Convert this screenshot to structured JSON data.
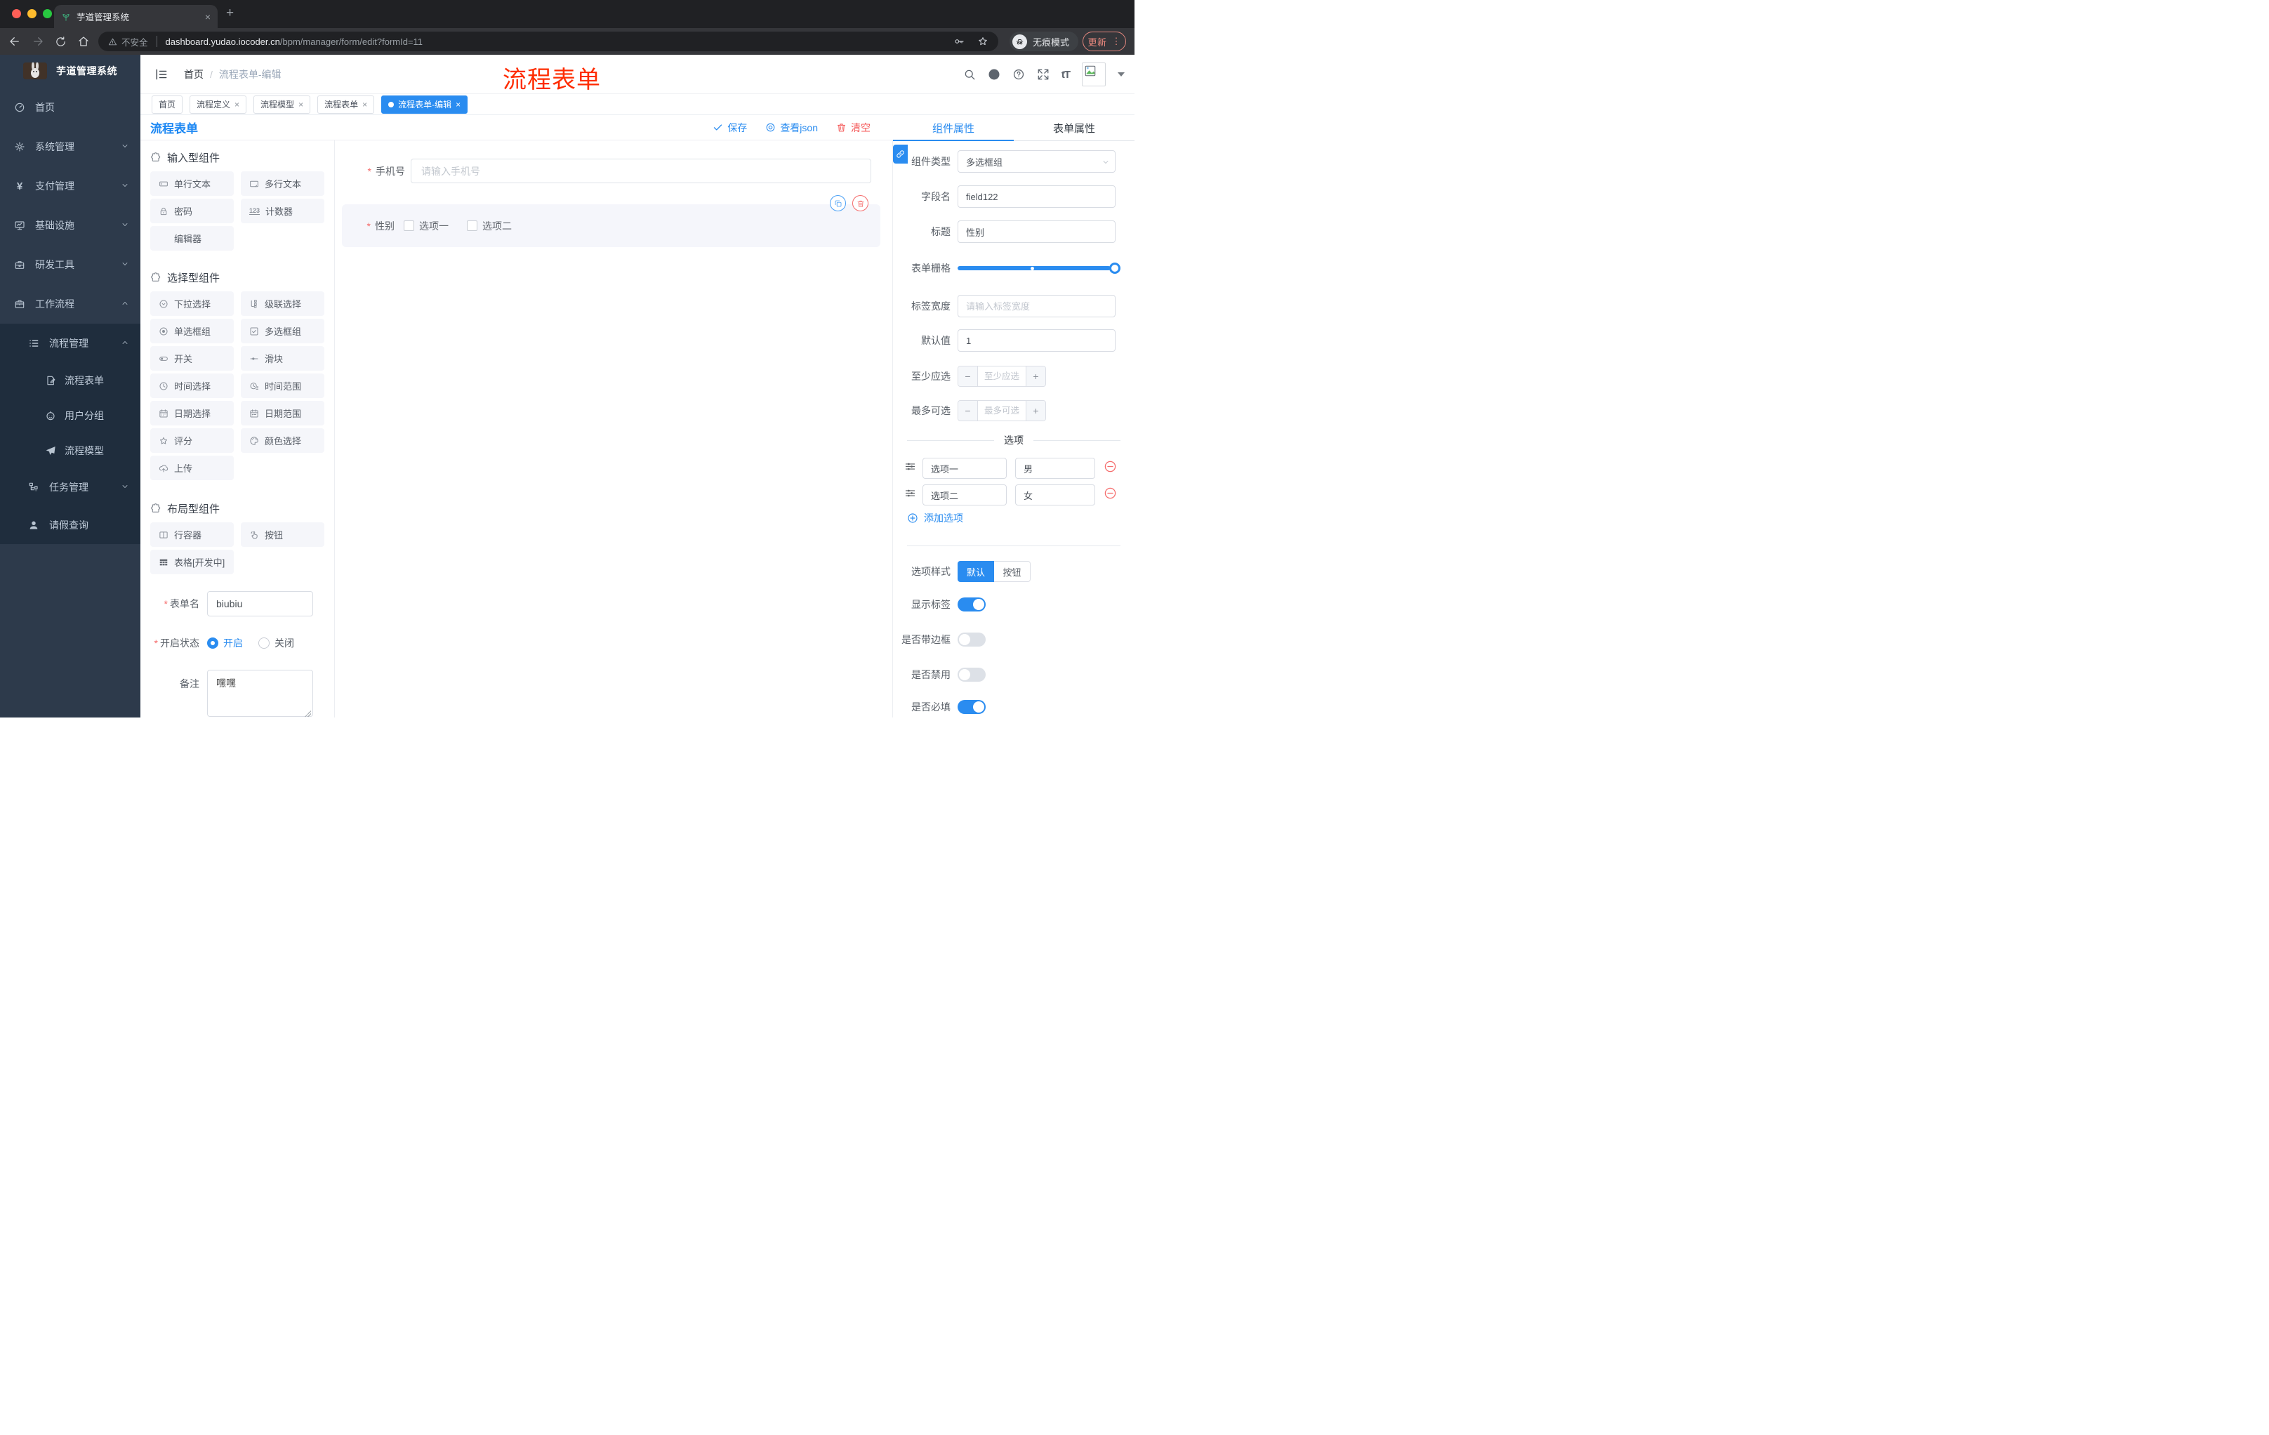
{
  "browser": {
    "tab_title": "芋道管理系统",
    "not_secure_label": "不安全",
    "url_host": "dashboard.yudao.iocoder.cn",
    "url_path": "/bpm/manager/form/edit?formId=11",
    "incognito_label": "无痕模式",
    "update_label": "更新"
  },
  "ui": {
    "close": "×",
    "plus": "+",
    "kebab": "⋮",
    "slash": "/",
    "asterisk": "*",
    "tT": "tT",
    "num": "123",
    "yen": "¥"
  },
  "sidebar": {
    "app_title": "芋道管理系统",
    "items": [
      {
        "label": "首页"
      },
      {
        "label": "系统管理"
      },
      {
        "label": "支付管理"
      },
      {
        "label": "基础设施"
      },
      {
        "label": "研发工具"
      },
      {
        "label": "工作流程"
      }
    ],
    "workflow": [
      {
        "label": "流程管理"
      },
      {
        "label": "流程表单"
      },
      {
        "label": "用户分组"
      },
      {
        "label": "流程模型"
      },
      {
        "label": "任务管理"
      },
      {
        "label": "请假查询"
      }
    ]
  },
  "header": {
    "breadcrumb_home": "首页",
    "breadcrumb_current": "流程表单-编辑",
    "annotation": "流程表单"
  },
  "tags": [
    {
      "label": "首页"
    },
    {
      "label": "流程定义"
    },
    {
      "label": "流程模型"
    },
    {
      "label": "流程表单"
    },
    {
      "label": "流程表单-编辑"
    }
  ],
  "designer": {
    "title": "流程表单",
    "save": "保存",
    "view_json": "查看json",
    "clear": "清空"
  },
  "palette": {
    "sections": [
      {
        "title": "输入型组件",
        "items": [
          {
            "label": "单行文本"
          },
          {
            "label": "多行文本"
          },
          {
            "label": "密码"
          },
          {
            "label": "计数器"
          },
          {
            "label": "编辑器"
          }
        ]
      },
      {
        "title": "选择型组件",
        "items": [
          {
            "label": "下拉选择"
          },
          {
            "label": "级联选择"
          },
          {
            "label": "单选框组"
          },
          {
            "label": "多选框组"
          },
          {
            "label": "开关"
          },
          {
            "label": "滑块"
          },
          {
            "label": "时间选择"
          },
          {
            "label": "时间范围"
          },
          {
            "label": "日期选择"
          },
          {
            "label": "日期范围"
          },
          {
            "label": "评分"
          },
          {
            "label": "颜色选择"
          },
          {
            "label": "上传"
          }
        ]
      },
      {
        "title": "布局型组件",
        "items": [
          {
            "label": "行容器"
          },
          {
            "label": "按钮"
          },
          {
            "label": "表格[开发中]"
          }
        ]
      }
    ]
  },
  "form_meta": {
    "name_label": "表单名",
    "name_value": "biubiu",
    "status_label": "开启状态",
    "status_on": "开启",
    "status_off": "关闭",
    "remark_label": "备注",
    "remark_value": "嘿嘿"
  },
  "canvas": {
    "phone_label": "手机号",
    "phone_placeholder": "请输入手机号",
    "gender_label": "性别",
    "gender_option1": "选项一",
    "gender_option2": "选项二"
  },
  "props": {
    "tab_component": "组件属性",
    "tab_form": "表单属性",
    "type_label": "组件类型",
    "type_value": "多选框组",
    "field_label": "字段名",
    "field_value": "field122",
    "title_label": "标题",
    "title_value": "性别",
    "grid_label": "表单栅格",
    "width_label": "标签宽度",
    "width_placeholder": "请输入标签宽度",
    "default_label": "默认值",
    "default_value": "1",
    "min_label": "至少应选",
    "min_placeholder": "至少应选",
    "max_label": "最多可选",
    "max_placeholder": "最多可选",
    "stepper_minus": "−",
    "stepper_plus": "+",
    "options_divider": "选项",
    "options": [
      {
        "label": "选项一",
        "value": "男"
      },
      {
        "label": "选项二",
        "value": "女"
      }
    ],
    "add_option": "添加选项",
    "style_label": "选项样式",
    "style_default": "默认",
    "style_button": "按钮",
    "switch_show_label": "显示标签",
    "switch_border": "是否带边框",
    "switch_disabled": "是否禁用",
    "switch_required": "是否必填"
  },
  "colors": {
    "accent": "#2a8cf0",
    "danger": "#f56c6c",
    "annotation_red": "#fe2c00",
    "sidebar_bg": "#2d3a4b",
    "submenu_bg": "#1f2d3d"
  }
}
